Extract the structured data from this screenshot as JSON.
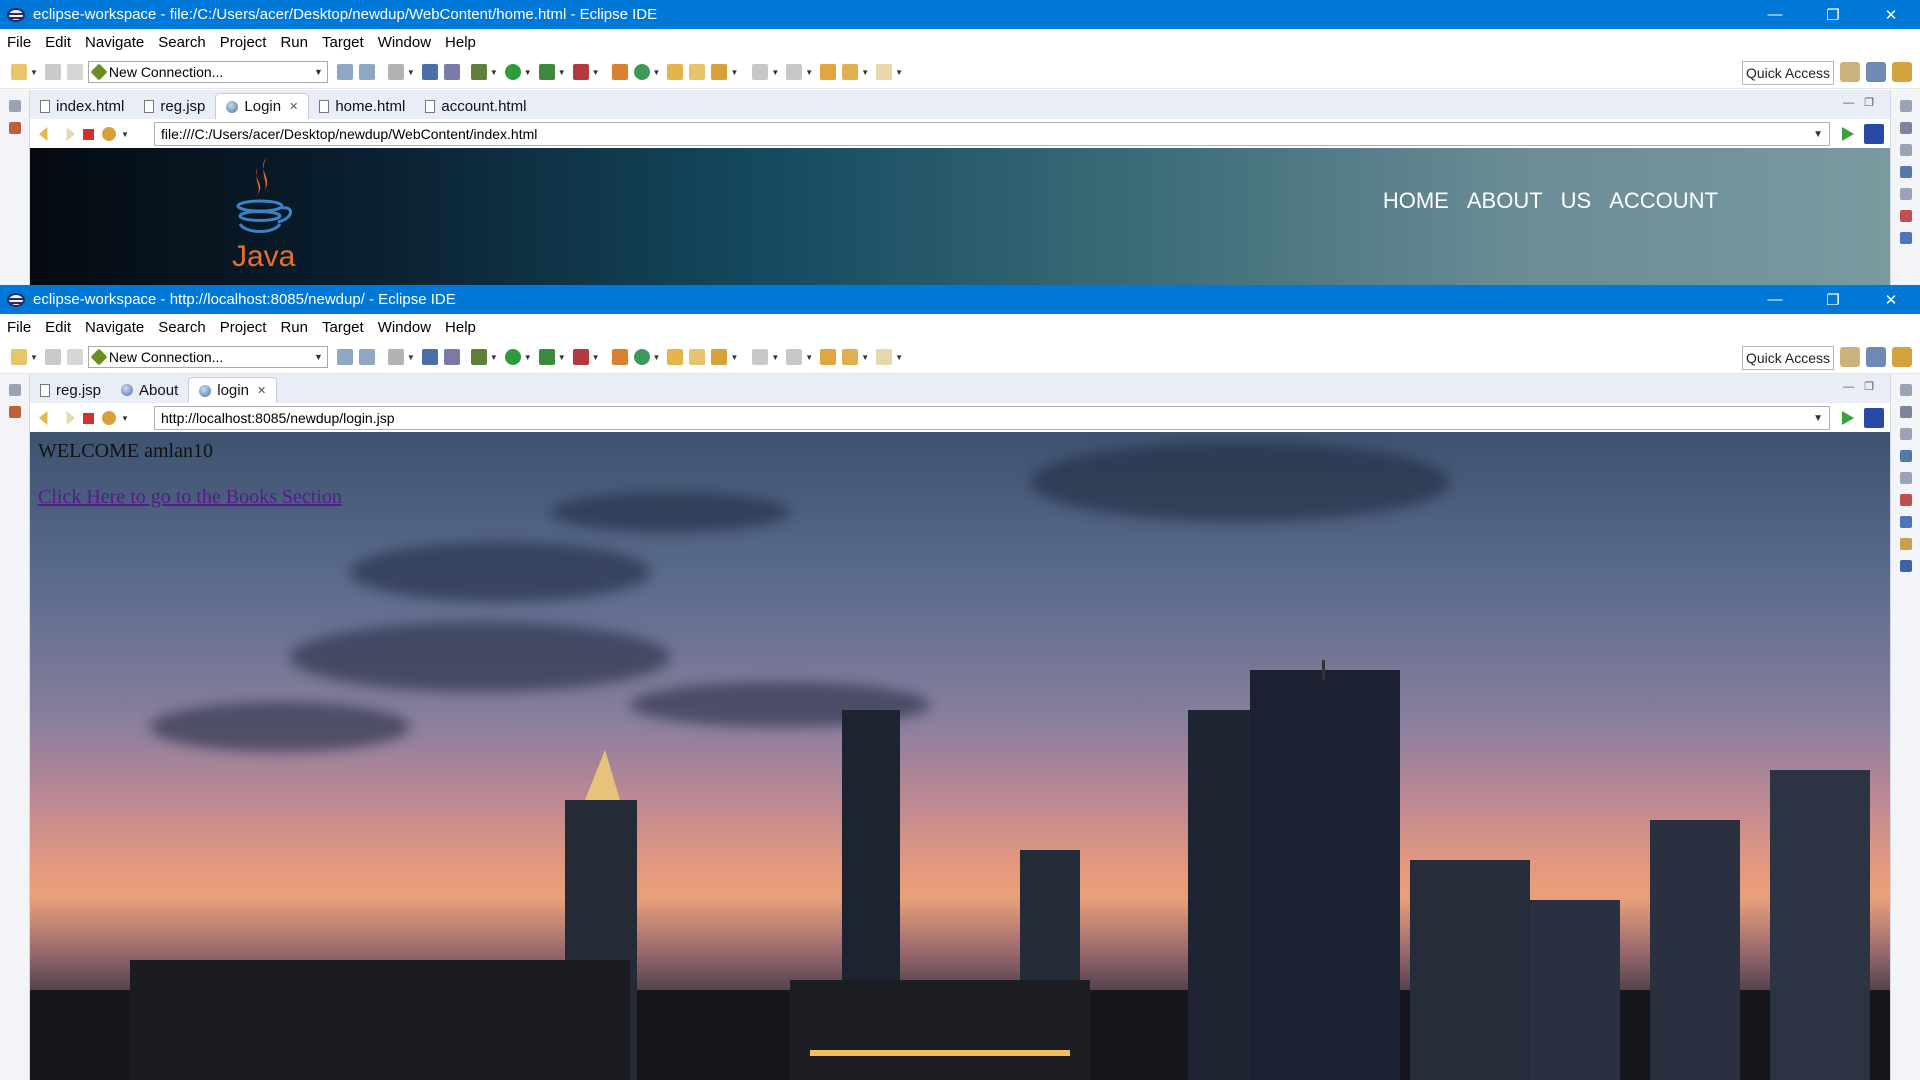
{
  "window1": {
    "title": "eclipse-workspace - file:/C:/Users/acer/Desktop/newdup/WebContent/home.html - Eclipse IDE",
    "menu": [
      "File",
      "Edit",
      "Navigate",
      "Search",
      "Project",
      "Run",
      "Target",
      "Window",
      "Help"
    ],
    "connection_value": "New Connection...",
    "quick_access": "Quick Access",
    "tabs": [
      {
        "label": "index.html",
        "icon": "file-icon",
        "active": false
      },
      {
        "label": "reg.jsp",
        "icon": "file-icon",
        "active": false
      },
      {
        "label": "Login",
        "icon": "globe-icon",
        "active": true
      },
      {
        "label": "home.html",
        "icon": "file-icon",
        "active": false
      },
      {
        "label": "account.html",
        "icon": "file-icon",
        "active": false
      }
    ],
    "url": "file:///C:/Users/acer/Desktop/newdup/WebContent/index.html",
    "site_nav": [
      "HOME",
      "ABOUT",
      "US",
      "ACCOUNT"
    ],
    "logo_text": "Java"
  },
  "window2": {
    "title": "eclipse-workspace - http://localhost:8085/newdup/ - Eclipse IDE",
    "menu": [
      "File",
      "Edit",
      "Navigate",
      "Search",
      "Project",
      "Run",
      "Target",
      "Window",
      "Help"
    ],
    "connection_value": "New Connection...",
    "quick_access": "Quick Access",
    "tabs": [
      {
        "label": "reg.jsp",
        "icon": "file-icon",
        "active": false
      },
      {
        "label": "About",
        "icon": "globe-icon",
        "active": false
      },
      {
        "label": "login",
        "icon": "globe-icon",
        "active": true
      }
    ],
    "url": "http://localhost:8085/newdup/login.jsp",
    "welcome_text": "WELCOME amlan10",
    "books_link": "Click Here to go to the Books Section"
  },
  "colors": {
    "titlebar": "#0078d7",
    "link_visited": "#551a8b",
    "tabbar": "#e9edf5"
  }
}
